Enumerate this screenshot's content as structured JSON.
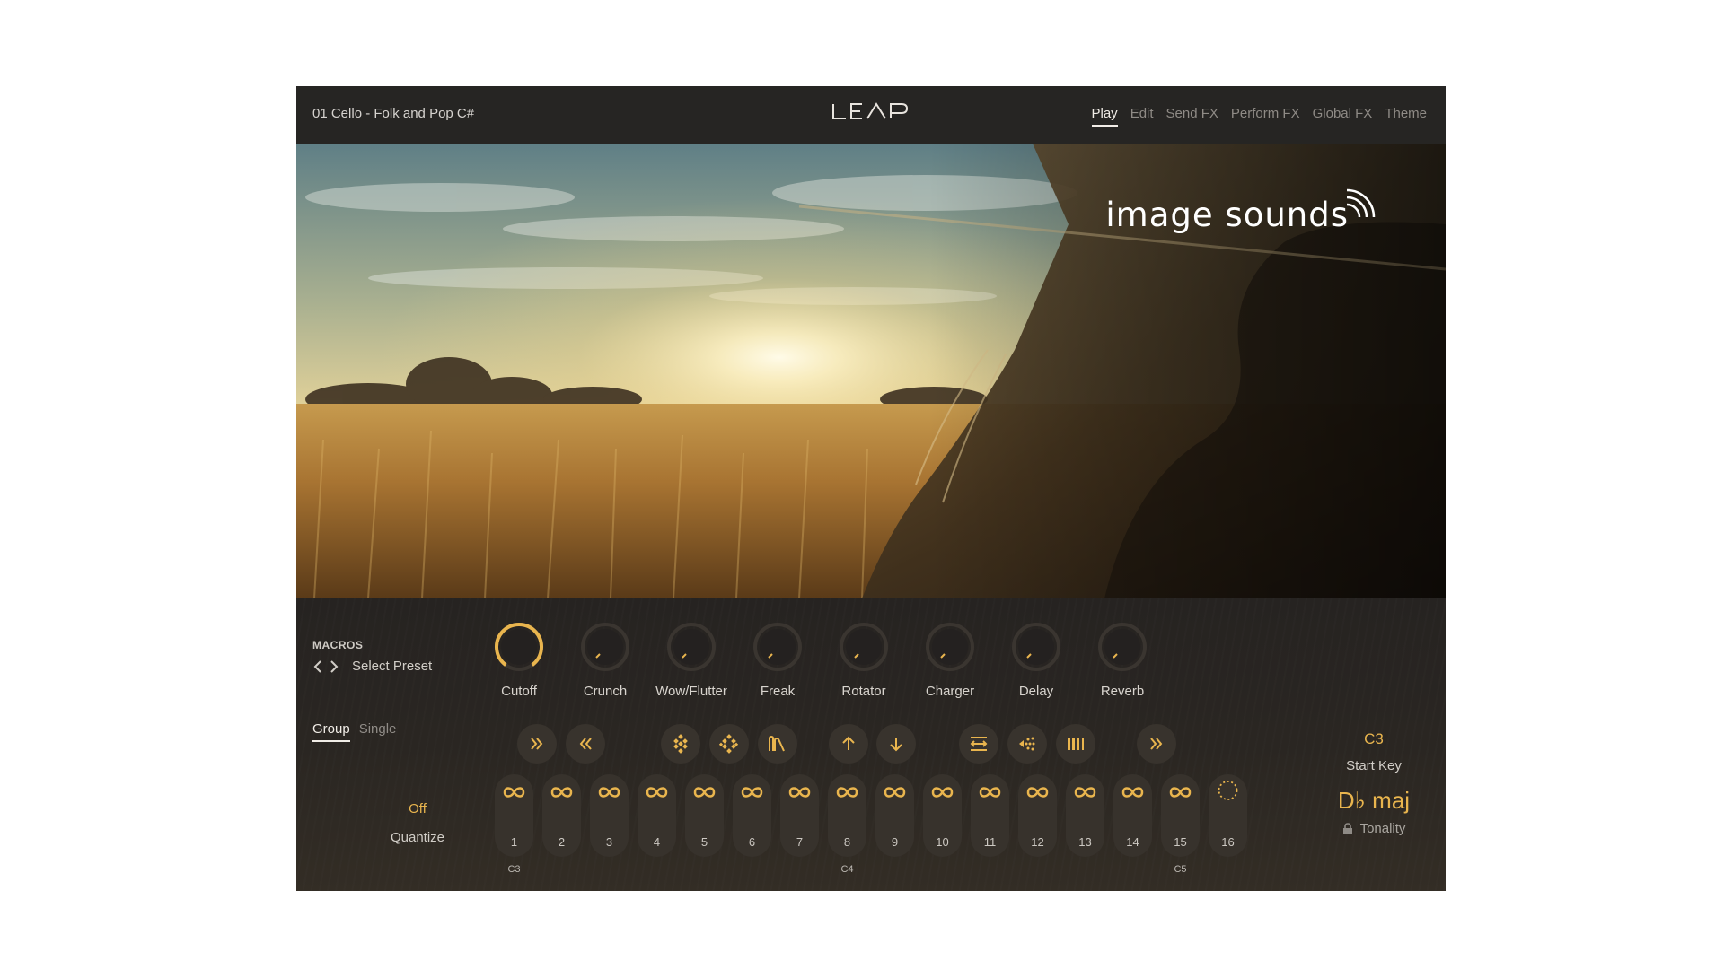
{
  "header": {
    "preset_title": "01 Cello - Folk and Pop C#",
    "logo": "LEAP",
    "tabs": [
      {
        "label": "Play",
        "active": true
      },
      {
        "label": "Edit",
        "active": false
      },
      {
        "label": "Send FX",
        "active": false
      },
      {
        "label": "Perform FX",
        "active": false
      },
      {
        "label": "Global FX",
        "active": false
      },
      {
        "label": "Theme",
        "active": false
      }
    ]
  },
  "artwork": {
    "brand": "image sounds",
    "brand_icon": "wifi-waves-icon"
  },
  "macros": {
    "heading": "MACROS",
    "select_preset": "Select Preset",
    "knobs": [
      {
        "label": "Cutoff",
        "value": 0.78,
        "active": true
      },
      {
        "label": "Crunch",
        "value": 0.0,
        "active": false
      },
      {
        "label": "Wow/Flutter",
        "value": 0.0,
        "active": false
      },
      {
        "label": "Freak",
        "value": 0.0,
        "active": false
      },
      {
        "label": "Rotator",
        "value": 0.0,
        "active": false
      },
      {
        "label": "Charger",
        "value": 0.0,
        "active": false
      },
      {
        "label": "Delay",
        "value": 0.0,
        "active": false
      },
      {
        "label": "Reverb",
        "value": 0.0,
        "active": false
      }
    ]
  },
  "mode": {
    "tabs": [
      {
        "label": "Group",
        "active": true
      },
      {
        "label": "Single",
        "active": false
      }
    ]
  },
  "quantize": {
    "value": "Off",
    "label": "Quantize"
  },
  "actions": [
    {
      "icon": "double-chevron-right-icon"
    },
    {
      "icon": "double-chevron-left-icon"
    },
    {
      "icon": "diamond-pattern-icon"
    },
    {
      "icon": "diamond-pattern-alt-icon"
    },
    {
      "icon": "waveform-bars-icon"
    },
    {
      "icon": "arrow-up-icon"
    },
    {
      "icon": "arrow-down-icon"
    },
    {
      "icon": "swap-lines-icon"
    },
    {
      "icon": "scatter-left-icon"
    },
    {
      "icon": "bars-icon"
    },
    {
      "icon": "double-chevron-right-icon"
    }
  ],
  "pads": [
    {
      "num": "1",
      "icon": "infinity-icon"
    },
    {
      "num": "2",
      "icon": "infinity-icon"
    },
    {
      "num": "3",
      "icon": "infinity-icon"
    },
    {
      "num": "4",
      "icon": "infinity-icon"
    },
    {
      "num": "5",
      "icon": "infinity-icon"
    },
    {
      "num": "6",
      "icon": "infinity-icon"
    },
    {
      "num": "7",
      "icon": "infinity-icon"
    },
    {
      "num": "8",
      "icon": "infinity-icon"
    },
    {
      "num": "9",
      "icon": "infinity-icon"
    },
    {
      "num": "10",
      "icon": "infinity-icon"
    },
    {
      "num": "11",
      "icon": "infinity-icon"
    },
    {
      "num": "12",
      "icon": "infinity-icon"
    },
    {
      "num": "13",
      "icon": "infinity-icon"
    },
    {
      "num": "14",
      "icon": "infinity-icon"
    },
    {
      "num": "15",
      "icon": "infinity-icon"
    },
    {
      "num": "16",
      "icon": "dotted-circle-icon"
    }
  ],
  "note_labels": [
    "C3",
    "C4",
    "C5"
  ],
  "start_key": {
    "value": "C3",
    "label": "Start Key"
  },
  "tonality": {
    "value": "D♭ maj",
    "label": "Tonality",
    "icon": "lock-icon"
  },
  "colors": {
    "accent": "#e9b54e",
    "panel": "#262523",
    "pad": "#37322c"
  }
}
